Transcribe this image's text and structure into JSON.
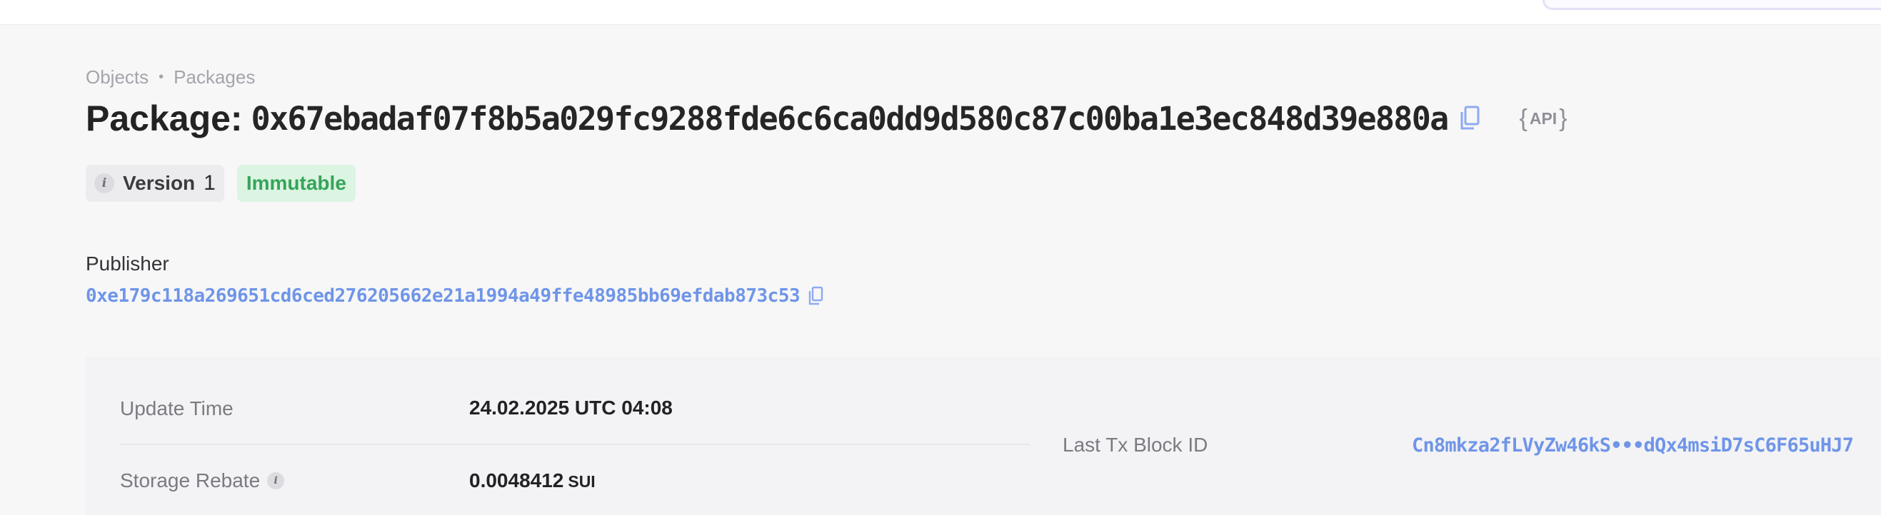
{
  "breadcrumb": {
    "items": [
      "Objects",
      "Packages"
    ],
    "separator": "•"
  },
  "header": {
    "title_label": "Package:",
    "address": "0x67ebadaf07f8b5a029fc9288fde6c6ca0dd9d580c87c00ba1e3ec848d39e880a",
    "copy_icon": "copy-icon",
    "api": {
      "open": "{",
      "label": "API",
      "close": "}"
    }
  },
  "badges": {
    "info_icon": "i",
    "version_label": "Version",
    "version_value": "1",
    "status": "Immutable"
  },
  "publisher": {
    "label": "Publisher",
    "address": "0xe179c118a269651cd6ced276205662e21a1994a49ffe48985bb69efdab873c53"
  },
  "details": {
    "update_time": {
      "label": "Update Time",
      "value": "24.02.2025 UTC 04:08"
    },
    "storage_rebate": {
      "label": "Storage Rebate",
      "value": "0.0048412",
      "unit": "SUI"
    },
    "last_tx_block": {
      "label": "Last Tx Block ID",
      "value": "Cn8mkza2fLVyZw46kS•••dQx4msiD7sC6F65uHJ7"
    }
  },
  "colors": {
    "background": "#f7f7f8",
    "link": "#6f95e8",
    "immutable_bg": "#dcf4e2",
    "immutable_text": "#35a45a",
    "muted_text": "#a4a4ac"
  }
}
